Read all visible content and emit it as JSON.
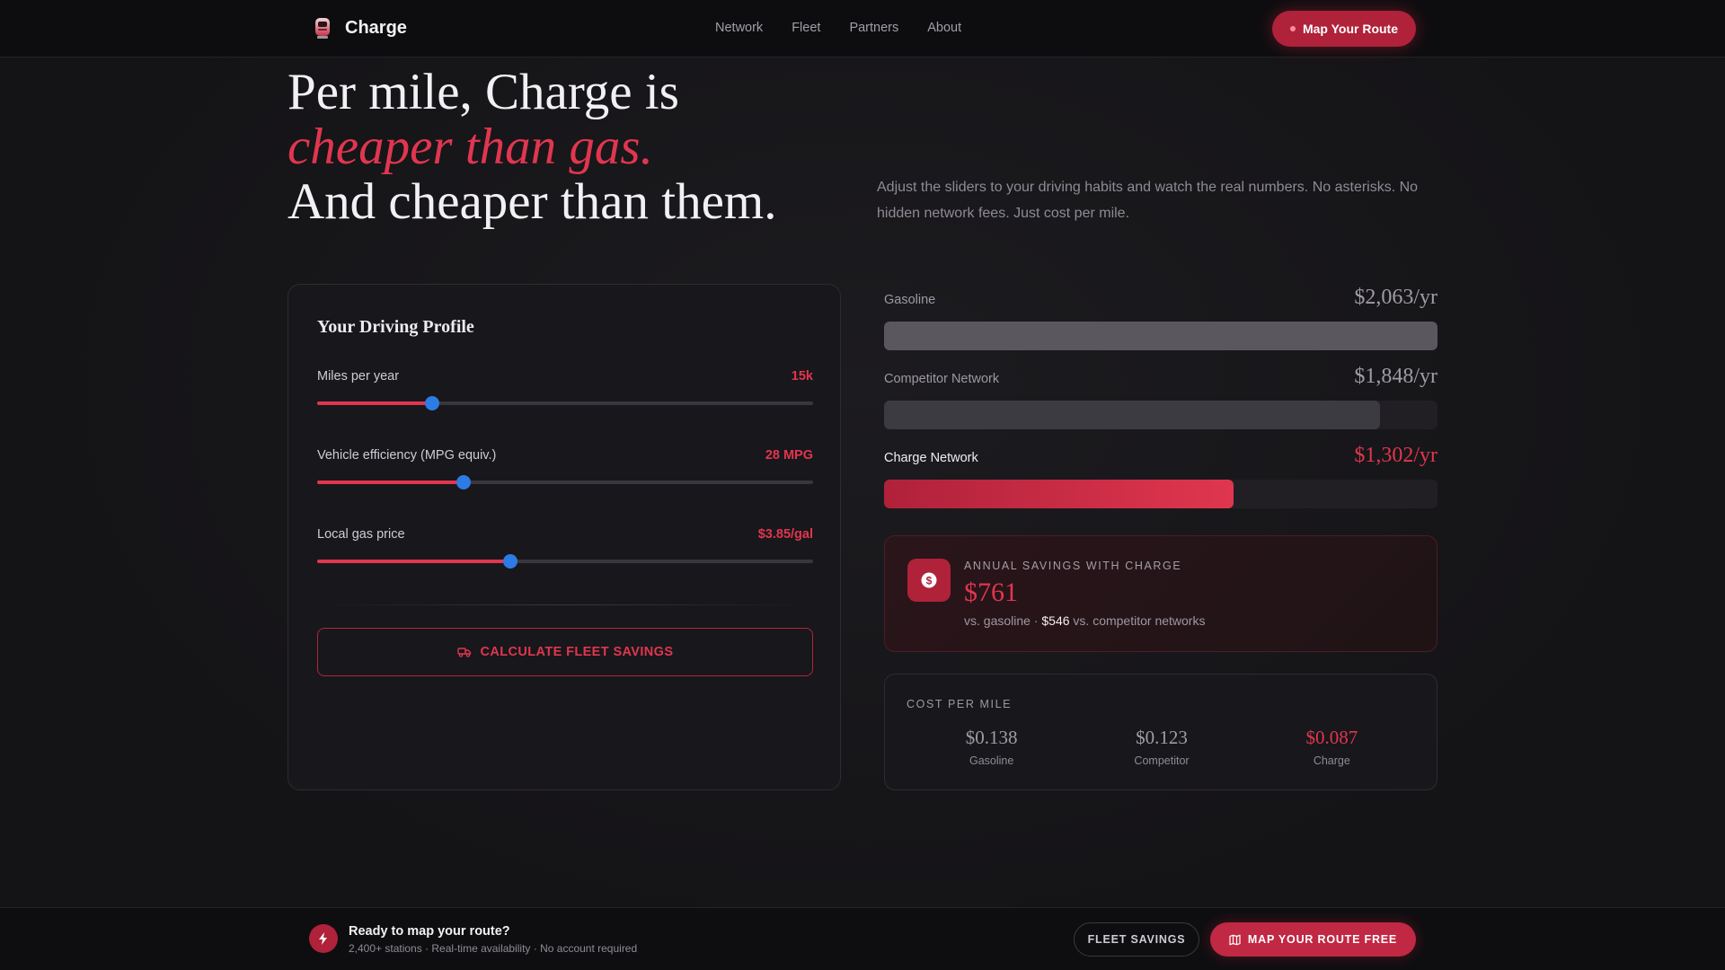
{
  "nav": {
    "brand": "Charge",
    "links": [
      "Network",
      "Fleet",
      "Partners",
      "About"
    ],
    "cta": "Map Your Route"
  },
  "hero": {
    "line1": "Per mile, Charge is",
    "line2": "cheaper than gas.",
    "line3": "And cheaper than them.",
    "description": "Adjust the sliders to your driving habits and watch the real numbers. No asterisks. No hidden network fees. Just cost per mile."
  },
  "profile": {
    "title": "Your Driving Profile",
    "sliders": [
      {
        "label": "Miles per year",
        "value": "15k",
        "fraction": 0.232
      },
      {
        "label": "Vehicle efficiency (MPG equiv.)",
        "value": "28 MPG",
        "fraction": 0.295
      },
      {
        "label": "Local gas price",
        "value": "$3.85/gal",
        "fraction": 0.389
      }
    ],
    "fleet_button": "CALCULATE FLEET SAVINGS"
  },
  "costs": [
    {
      "label": "Gasoline",
      "amount": "$2,063/yr",
      "value": 2063,
      "highlight": false
    },
    {
      "label": "Competitor Network",
      "amount": "$1,848/yr",
      "value": 1848,
      "highlight": false
    },
    {
      "label": "Charge Network",
      "amount": "$1,302/yr",
      "value": 1302,
      "highlight": true
    }
  ],
  "savings": {
    "kicker": "ANNUAL SAVINGS WITH CHARGE",
    "amount": "$761",
    "detail_prefix": "vs. gasoline · ",
    "detail_strong": "$546",
    "detail_suffix": " vs. competitor networks"
  },
  "cost_per_mile": {
    "kicker": "COST PER MILE",
    "items": [
      {
        "value": "$0.138",
        "name": "Gasoline",
        "highlight": false
      },
      {
        "value": "$0.123",
        "name": "Competitor",
        "highlight": false
      },
      {
        "value": "$0.087",
        "name": "Charge",
        "highlight": true
      }
    ]
  },
  "footer": {
    "title": "Ready to map your route?",
    "subtitle": "2,400+ stations · Real-time availability · No account required",
    "secondary": "FLEET SAVINGS",
    "primary": "MAP YOUR ROUTE FREE"
  },
  "colors": {
    "accent": "#e0364f",
    "accent_dark": "#b0213a",
    "thumb": "#2d7be5",
    "gas_bar": "#5a585e",
    "competitor_bar": "#3c3b42"
  }
}
